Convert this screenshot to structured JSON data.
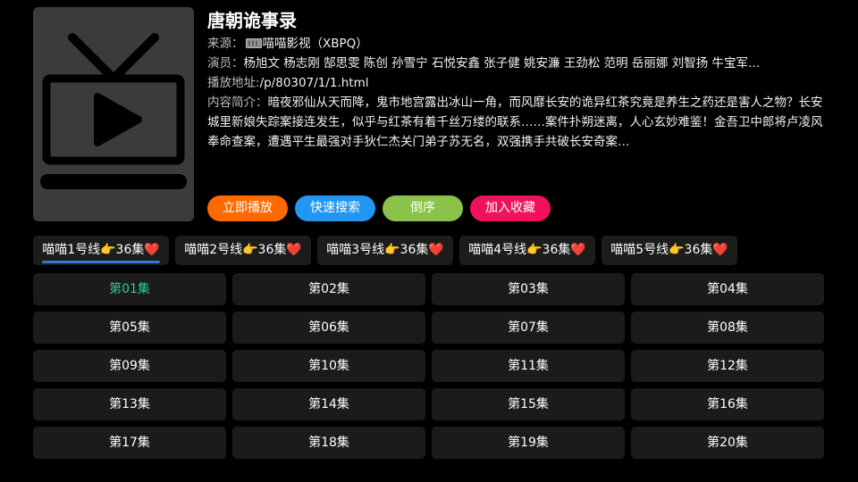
{
  "detail": {
    "title": "唐朝诡事录",
    "source_label": "来源：",
    "source_value": "喵喵影视（XBPQ）",
    "actors_label": "演员：",
    "actors_value": "杨旭文 杨志刚 郜思雯 陈创 孙雪宁 石悦安鑫 张子健 姚安濂 王劲松 范明 岳丽娜 刘智扬 牛宝军…",
    "play_url_label": "播放地址:",
    "play_url_value": "/p/80307/1/1.html",
    "intro_label": "内容简介：",
    "intro_value": "暗夜邪仙从天而降，鬼市地宫露出冰山一角，而风靡长安的诡异红茶究竟是养生之药还是害人之物？长安城里新娘失踪案接连发生，似乎与红茶有着千丝万缕的联系……案件扑朔迷离，人心玄妙难鉴！金吾卫中郎将卢凌风奉命查案，遭遇平生最强对手狄仁杰关门弟子苏无名，双强携手共破长安奇案…"
  },
  "actions": [
    {
      "label": "立即播放",
      "color": "#ff6a00"
    },
    {
      "label": "快速搜索",
      "color": "#2196f3"
    },
    {
      "label": "倒序",
      "color": "#8bc34a"
    },
    {
      "label": "加入收藏",
      "color": "#f0125f"
    }
  ],
  "lines": [
    {
      "label": "喵喵1号线👉36集❤️",
      "selected": true
    },
    {
      "label": "喵喵2号线👉36集❤️",
      "selected": false
    },
    {
      "label": "喵喵3号线👉36集❤️",
      "selected": false
    },
    {
      "label": "喵喵4号线👉36集❤️",
      "selected": false
    },
    {
      "label": "喵喵5号线👉36集❤️",
      "selected": false
    }
  ],
  "episodes": [
    "第01集",
    "第02集",
    "第03集",
    "第04集",
    "第05集",
    "第06集",
    "第07集",
    "第08集",
    "第09集",
    "第10集",
    "第11集",
    "第12集",
    "第13集",
    "第14集",
    "第15集",
    "第16集",
    "第17集",
    "第18集",
    "第19集",
    "第20集"
  ],
  "active_episode_index": 0,
  "colors": {
    "active_episode_text": "#30c9a8",
    "line_underline": "#2e7bd6",
    "poster_bg": "#3b3b3b",
    "poster_icon": "#000000"
  },
  "icons": {
    "poster": "tv-play-icon",
    "source": "film-strip-icon"
  }
}
